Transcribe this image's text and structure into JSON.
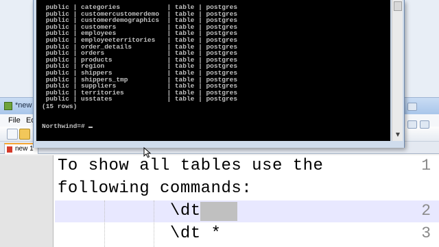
{
  "console": {
    "rows": [
      {
        "schema": "public",
        "name": "categories",
        "type": "table",
        "owner": "postgres"
      },
      {
        "schema": "public",
        "name": "customercustomerdemo",
        "type": "table",
        "owner": "postgres"
      },
      {
        "schema": "public",
        "name": "customerdemographics",
        "type": "table",
        "owner": "postgres"
      },
      {
        "schema": "public",
        "name": "customers",
        "type": "table",
        "owner": "postgres"
      },
      {
        "schema": "public",
        "name": "employees",
        "type": "table",
        "owner": "postgres"
      },
      {
        "schema": "public",
        "name": "employeeterritories",
        "type": "table",
        "owner": "postgres"
      },
      {
        "schema": "public",
        "name": "order_details",
        "type": "table",
        "owner": "postgres"
      },
      {
        "schema": "public",
        "name": "orders",
        "type": "table",
        "owner": "postgres"
      },
      {
        "schema": "public",
        "name": "products",
        "type": "table",
        "owner": "postgres"
      },
      {
        "schema": "public",
        "name": "region",
        "type": "table",
        "owner": "postgres"
      },
      {
        "schema": "public",
        "name": "shippers",
        "type": "table",
        "owner": "postgres"
      },
      {
        "schema": "public",
        "name": "shippers_tmp",
        "type": "table",
        "owner": "postgres"
      },
      {
        "schema": "public",
        "name": "suppliers",
        "type": "table",
        "owner": "postgres"
      },
      {
        "schema": "public",
        "name": "territories",
        "type": "table",
        "owner": "postgres"
      },
      {
        "schema": "public",
        "name": "usstates",
        "type": "table",
        "owner": "postgres"
      }
    ],
    "row_count": "(15 rows)",
    "prompt": "Northwind=# ",
    "scroll_down_glyph": "▼"
  },
  "editor": {
    "title": "*new",
    "menu": {
      "file": "File",
      "edit": "Ed"
    },
    "tab_label": "new 1",
    "lines": [
      {
        "number": "1",
        "text": "To show all tables use the"
      },
      {
        "number": "",
        "text": "following commands:"
      },
      {
        "number": "2",
        "text": "           \\dt"
      },
      {
        "number": "3",
        "text": "           \\dt *"
      }
    ]
  }
}
